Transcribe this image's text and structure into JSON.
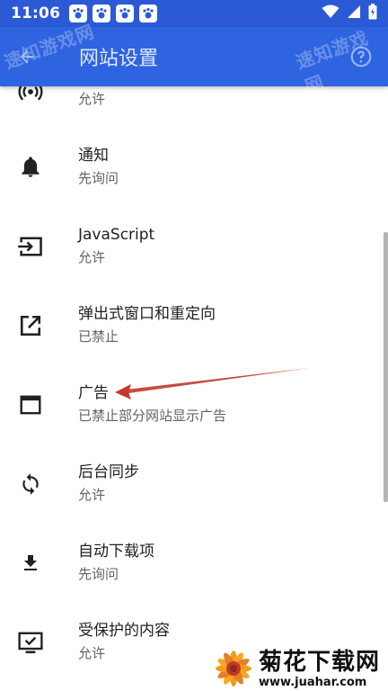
{
  "status_bar": {
    "time": "11:06"
  },
  "app_bar": {
    "title": "网站设置"
  },
  "watermark": {
    "left": "速知游戏网",
    "right": "速知游戏网"
  },
  "settings": [
    {
      "title": "",
      "subtitle": "允许",
      "icon": "sensors-icon"
    },
    {
      "title": "通知",
      "subtitle": "先询问",
      "icon": "bell-icon"
    },
    {
      "title": "JavaScript",
      "subtitle": "允许",
      "icon": "javascript-icon"
    },
    {
      "title": "弹出式窗口和重定向",
      "subtitle": "已禁止",
      "icon": "popup-external-icon"
    },
    {
      "title": "广告",
      "subtitle": "已禁止部分网站显示广告",
      "icon": "ads-window-icon"
    },
    {
      "title": "后台同步",
      "subtitle": "允许",
      "icon": "sync-icon"
    },
    {
      "title": "自动下载项",
      "subtitle": "先询问",
      "icon": "download-icon"
    },
    {
      "title": "受保护的内容",
      "subtitle": "允许",
      "icon": "protected-content-icon"
    }
  ],
  "logo": {
    "main": "菊花下载网",
    "url": "www.juahar.com"
  },
  "colors": {
    "status_bar": "#2c5ad6",
    "app_bar": "#2f64e0",
    "arrow": "#c0392b"
  }
}
